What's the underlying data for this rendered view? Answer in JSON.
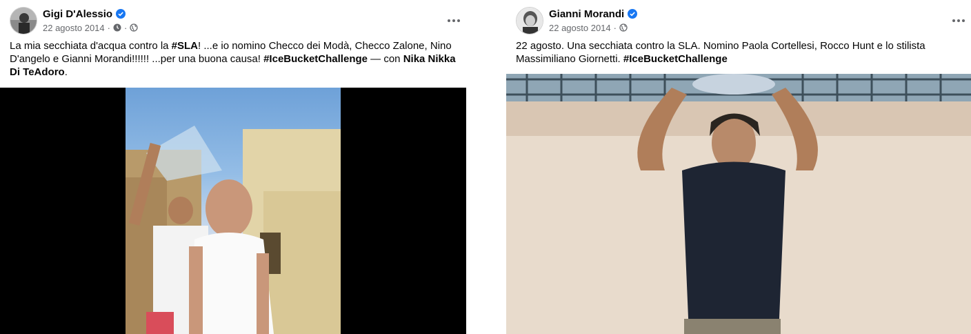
{
  "posts": [
    {
      "author": "Gigi D'Alessio",
      "date": "22 agosto 2014",
      "text": {
        "p1": "La mia secchiata d'acqua contro la ",
        "tag1": "#SLA",
        "p2": "! ...e io nomino Checco dei Modà, Checco Zalone, Nino D'angelo e Gianni Morandi!!!!!!  ...per una buona causa! ",
        "tag2": "#IceBucketChallenge",
        "p3": " — con ",
        "with": "Nika Nikka Di TeAdoro",
        "p4": "."
      },
      "icons": [
        "verified-badge-icon",
        "clock-icon",
        "globe-icon",
        "more-options-icon"
      ]
    },
    {
      "author": "Gianni Morandi",
      "date": "22 agosto 2014",
      "text": {
        "p1": "22 agosto. Una secchiata contro la SLA. Nomino Paola Cortellesi, Rocco Hunt e lo stilista Massimiliano Giornetti.  ",
        "tag1": "#IceBucketChallenge"
      },
      "icons": [
        "verified-badge-icon",
        "globe-icon",
        "more-options-icon"
      ]
    }
  ],
  "colors": {
    "text": "#050505",
    "meta": "#65676b",
    "verified": "#1877f2",
    "video_letterbox": "#000000"
  }
}
